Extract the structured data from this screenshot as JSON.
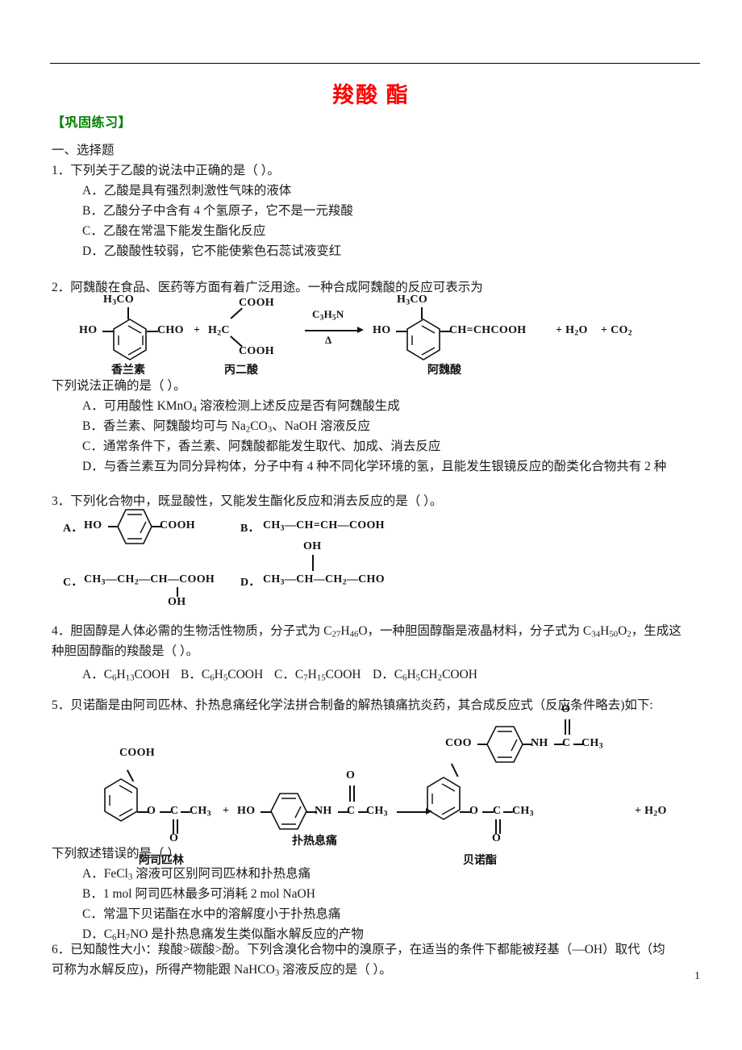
{
  "document": {
    "title": "羧酸 酯",
    "title_color": "#ff0000",
    "section_heading": "【巩固练习】",
    "section_heading_color": "#008000",
    "part_label": "一、选择题",
    "page_number": "1"
  },
  "questions": [
    {
      "number": "1",
      "stem": "1．下列关于乙酸的说法中正确的是（      ）。",
      "options": [
        "A．乙酸是具有强烈刺激性气味的液体",
        "B．乙酸分子中含有 4 个氢原子，它不是一元羧酸",
        "C．乙酸在常温下能发生酯化反应",
        "D．乙酸酸性较弱，它不能使紫色石蕊试液变红"
      ]
    },
    {
      "number": "2",
      "stem": "2．阿魏酸在食品、医药等方面有着广泛用途。一种合成阿魏酸的反应可表示为",
      "sub_stem": "下列说法正确的是（      ）。",
      "options": [
        "A．可用酸性 KMnO4 溶液检测上述反应是否有阿魏酸生成",
        "B．香兰素、阿魏酸均可与 Na2CO3、NaOH 溶液反应",
        "C．通常条件下，香兰素、阿魏酸都能发生取代、加成、消去反应",
        "D．与香兰素互为同分异构体，分子中有 4 种不同化学环境的氢，且能发生银镜反应的酚类化合物共有 2 种"
      ],
      "scheme": {
        "reactant1_name": "香兰素",
        "reactant2_name": "丙二酸",
        "product_name": "阿魏酸",
        "reactant1_groups": [
          "H3CO",
          "HO",
          "CHO"
        ],
        "reactant2_groups": [
          "H2C",
          "COOH",
          "COOH"
        ],
        "arrow_above": "C3H5N",
        "arrow_below": "Δ",
        "product_groups": [
          "H3CO",
          "HO",
          "CH",
          "CHCOOH"
        ],
        "byproducts": [
          "H2O",
          "CO2"
        ],
        "plus": "+"
      }
    },
    {
      "number": "3",
      "stem": "3．下列化合物中，既显酸性，又能发生酯化反应和消去反应的是（      ）。",
      "structures": {
        "A": {
          "letter": "A．",
          "left": "HO",
          "right": "COOH",
          "type": "benzene"
        },
        "B": {
          "letter": "B．",
          "chain": "CH3—CH=CH—COOH",
          "type": "chain"
        },
        "C": {
          "letter": "C．",
          "chain": "CH3—CH2—CH—COOH",
          "branch": "OH",
          "type": "chain-branch-down"
        },
        "D": {
          "letter": "D．",
          "chain": "CH3—CH—CH2—CHO",
          "branch": "OH",
          "type": "chain-branch-up"
        }
      }
    },
    {
      "number": "4",
      "stem_line1": "4．胆固醇是人体必需的生物活性物质，分子式为 C27H46O，一种胆固醇酯是液晶材料，分子式为 C34H50O2，生成这",
      "stem_line2": "种胆固醇酯的羧酸是（      ）。",
      "options_inline": [
        "A．C6H13COOH",
        "B．C6H5COOH",
        "C．C7H15COOH",
        "D．C6H5CH2COOH"
      ]
    },
    {
      "number": "5",
      "stem": "5．贝诺酯是由阿司匹林、扑热息痛经化学法拼合制备的解热镇痛抗炎药，其合成反应式（反应条件略去)如下:",
      "sub_stem": "下列叙述错误的是（  ）。",
      "options": [
        "A．FeCl3 溶液可区别阿司匹林和扑热息痛",
        "B．1 mol 阿司匹林最多可消耗 2 mol NaOH",
        "C．常温下贝诺酯在水中的溶解度小于扑热息痛",
        "D．C6H7NO 是扑热息痛发生类似酯水解反应的产物"
      ],
      "scheme": {
        "reactant1_name": "阿司匹林",
        "reactant2_name": "扑热息痛",
        "product_name": "贝诺酯",
        "byproduct": "+ H2O",
        "groups": [
          "COOH",
          "O",
          "C",
          "CH3",
          "HO",
          "NH",
          "COO"
        ],
        "plus": "+"
      }
    },
    {
      "number": "6",
      "stem_line1": "6．已知酸性大小：羧酸>碳酸>酚。下列含溴化合物中的溴原子，在适当的条件下都能被羟基（—OH）取代（均",
      "stem_line2": "可称为水解反应)，所得产物能跟 NaHCO3 溶液反应的是（      ）。"
    }
  ]
}
